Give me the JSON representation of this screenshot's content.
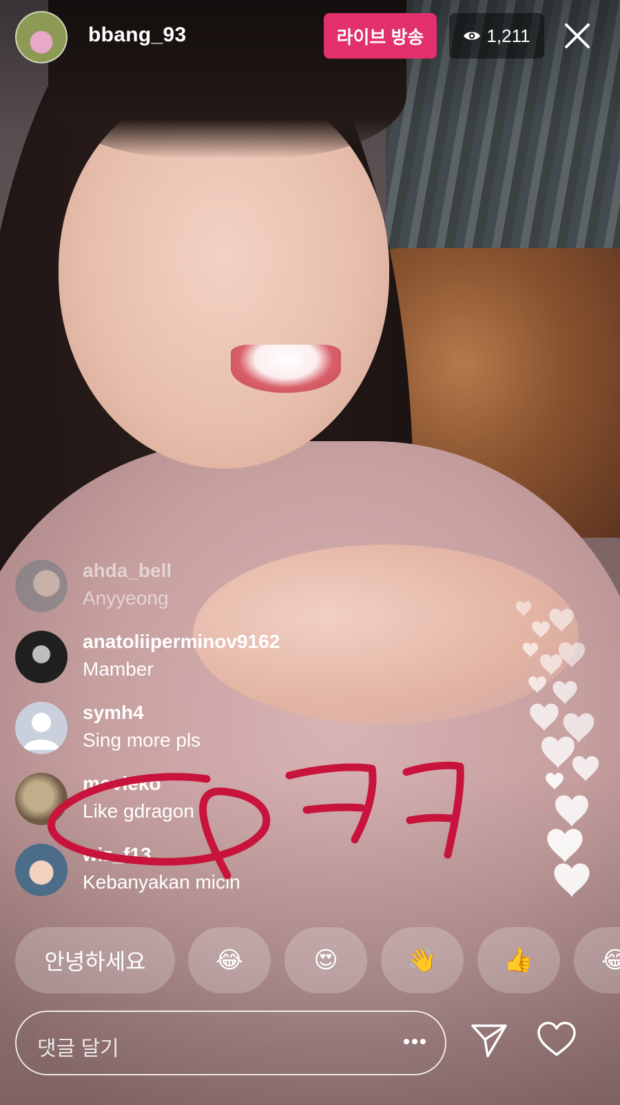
{
  "header": {
    "username": "bbang_93",
    "live_label": "라이브 방송",
    "viewer_count": "1,211"
  },
  "comments": [
    {
      "username": "ahda_bell",
      "text": "Anyyeong"
    },
    {
      "username": "anatoliiperminov9162",
      "text": "Mamber"
    },
    {
      "username": "symh4",
      "text": "Sing more pls"
    },
    {
      "username": "movieko",
      "text": "Like gdragon"
    },
    {
      "username": "wiz_f13",
      "text": "Kebanyakan micin"
    }
  ],
  "quick_replies": {
    "text_reply": "안녕하세요",
    "emoji_1": "😂",
    "emoji_2": "😍",
    "emoji_3": "👋",
    "emoji_4": "👍",
    "emoji_5": "😂"
  },
  "composer": {
    "placeholder": "댓글 달기"
  },
  "annotation": {
    "text": "ㅋㅋ",
    "color": "#c8143c"
  },
  "colors": {
    "live_badge": "#e1306c"
  },
  "icons": {
    "viewer": "eye-icon",
    "close": "close-icon",
    "more": "more-horizontal-icon",
    "send": "send-icon",
    "like": "heart-icon"
  }
}
